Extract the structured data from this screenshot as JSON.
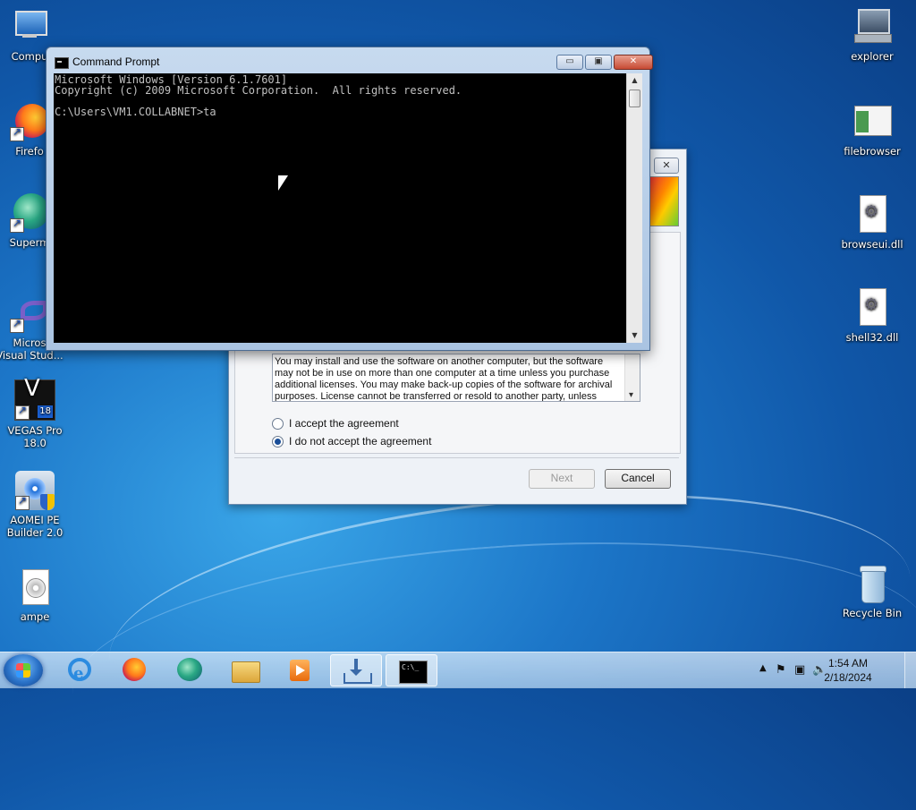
{
  "desktop": {
    "left_icons": [
      {
        "label": "Compu"
      },
      {
        "label": "Firefo"
      },
      {
        "label": "Superm"
      },
      {
        "label": "Micros\nVisual Stud..."
      },
      {
        "label": "VEGAS Pro\n18.0"
      },
      {
        "label": "AOMEI PE\nBuilder 2.0"
      },
      {
        "label": "ampe"
      }
    ],
    "right_icons": [
      {
        "label": "explorer"
      },
      {
        "label": "filebrowser"
      },
      {
        "label": "browseui.dll"
      },
      {
        "label": "shell32.dll"
      },
      {
        "label": "Recycle Bin"
      }
    ]
  },
  "installer": {
    "close_label": "✕",
    "license_text": "You may install and use the software on another computer, but the software may not be in use on more than one computer at a time unless you purchase additional licenses. You may make back-up copies of the software for archival purposes. License cannot be transferred or resold to another party, unless agreement was",
    "accept_label": "I accept the agreement",
    "decline_label": "I do not accept the agreement",
    "next_label": "Next",
    "cancel_label": "Cancel"
  },
  "cmd": {
    "title": "Command Prompt",
    "minimize": "▭",
    "maximize": "▣",
    "close": "✕",
    "console": "Microsoft Windows [Version 6.1.7601]\nCopyright (c) 2009 Microsoft Corporation.  All rights reserved.\n\nC:\\Users\\VM1.COLLABNET>ta"
  },
  "taskbar": {
    "time": "1:54 AM",
    "date": "2/18/2024",
    "vegas_badge": "18",
    "cmd_glyph": "C:\\_"
  },
  "colors": {
    "accent": "#1057a8",
    "console_bg": "#000000",
    "console_fg": "#c0c0c0",
    "close_button": "#c74a33"
  }
}
